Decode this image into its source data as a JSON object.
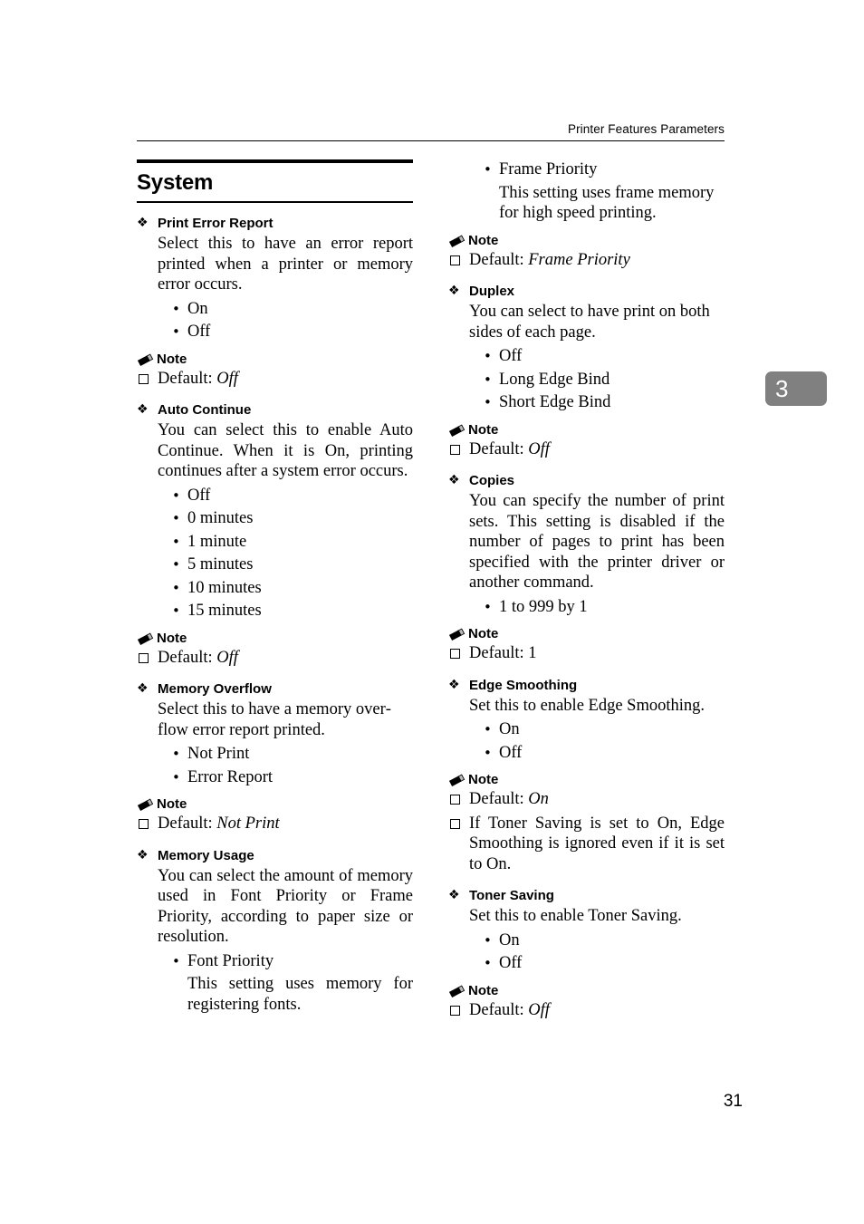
{
  "header": {
    "running_title": "Printer Features Parameters"
  },
  "chapter_tab": {
    "number": "3"
  },
  "page_number": "31",
  "section": {
    "title": "System"
  },
  "icons": {
    "diamond": "❖",
    "bullet": "•",
    "note_label": "Note"
  },
  "left_column": {
    "params": [
      {
        "name": "Print Error Report",
        "description": "Select this to have an error report printed when a printer or memory error occurs.",
        "options": [
          "On",
          "Off"
        ],
        "note_label": "Note",
        "notes": [
          {
            "prefix": "Default: ",
            "value": "Off",
            "italic": true
          }
        ]
      },
      {
        "name": "Auto Continue",
        "description": "You can select this to enable Auto Continue. When it is On, printing continues after a system error oc­curs.",
        "options": [
          "Off",
          "0 minutes",
          "1 minute",
          "5 minutes",
          "10 minutes",
          "15 minutes"
        ],
        "note_label": "Note",
        "notes": [
          {
            "prefix": "Default: ",
            "value": "Off",
            "italic": true
          }
        ]
      },
      {
        "name": "Memory Overflow",
        "description": "Select this to have a memory over­flow error report printed.",
        "options": [
          "Not Print",
          "Error Report"
        ],
        "note_label": "Note",
        "notes": [
          {
            "prefix": "Default: ",
            "value": "Not Print",
            "italic": true
          }
        ]
      },
      {
        "name": "Memory Usage",
        "description": "You can select the amount of mem­ory used in Font Priority or Frame Priority, according to paper size or resolution.",
        "options": [
          "Font Priority"
        ],
        "option_sub": "This setting uses memory for registering fonts.",
        "note_label": "",
        "notes": []
      }
    ]
  },
  "right_column": {
    "continuation": {
      "option": "Frame Priority",
      "option_sub": "This setting uses frame memory for high speed printing.",
      "note_label": "Note",
      "notes": [
        {
          "prefix": "Default: ",
          "value": "Frame Priority",
          "italic": true
        }
      ]
    },
    "params": [
      {
        "name": "Duplex",
        "description": "You can select to have print on both sides of each page.",
        "options": [
          "Off",
          "Long Edge Bind",
          "Short Edge Bind"
        ],
        "note_label": "Note",
        "notes": [
          {
            "prefix": "Default: ",
            "value": "Off",
            "italic": true
          }
        ]
      },
      {
        "name": "Copies",
        "description": "You can specify the number of print sets. This setting is disabled if the number of pages to print has been specified with the printer driver or another command.",
        "options": [
          "1 to 999 by 1"
        ],
        "note_label": "Note",
        "notes": [
          {
            "prefix": "Default: ",
            "value": "1",
            "italic": false
          }
        ]
      },
      {
        "name": "Edge Smoothing",
        "description": "Set this to enable Edge Smoothing.",
        "options": [
          "On",
          "Off"
        ],
        "note_label": "Note",
        "notes": [
          {
            "prefix": "Default: ",
            "value": "On",
            "italic": true
          },
          {
            "prefix": "",
            "value": "If Toner Saving is set to On, Edge Smoothing is ignored even if it is set to On.",
            "italic": false
          }
        ]
      },
      {
        "name": "Toner Saving",
        "description": "Set this to enable Toner Saving.",
        "options": [
          "On",
          "Off"
        ],
        "note_label": "Note",
        "notes": [
          {
            "prefix": "Default: ",
            "value": "Off",
            "italic": true
          }
        ]
      }
    ]
  }
}
